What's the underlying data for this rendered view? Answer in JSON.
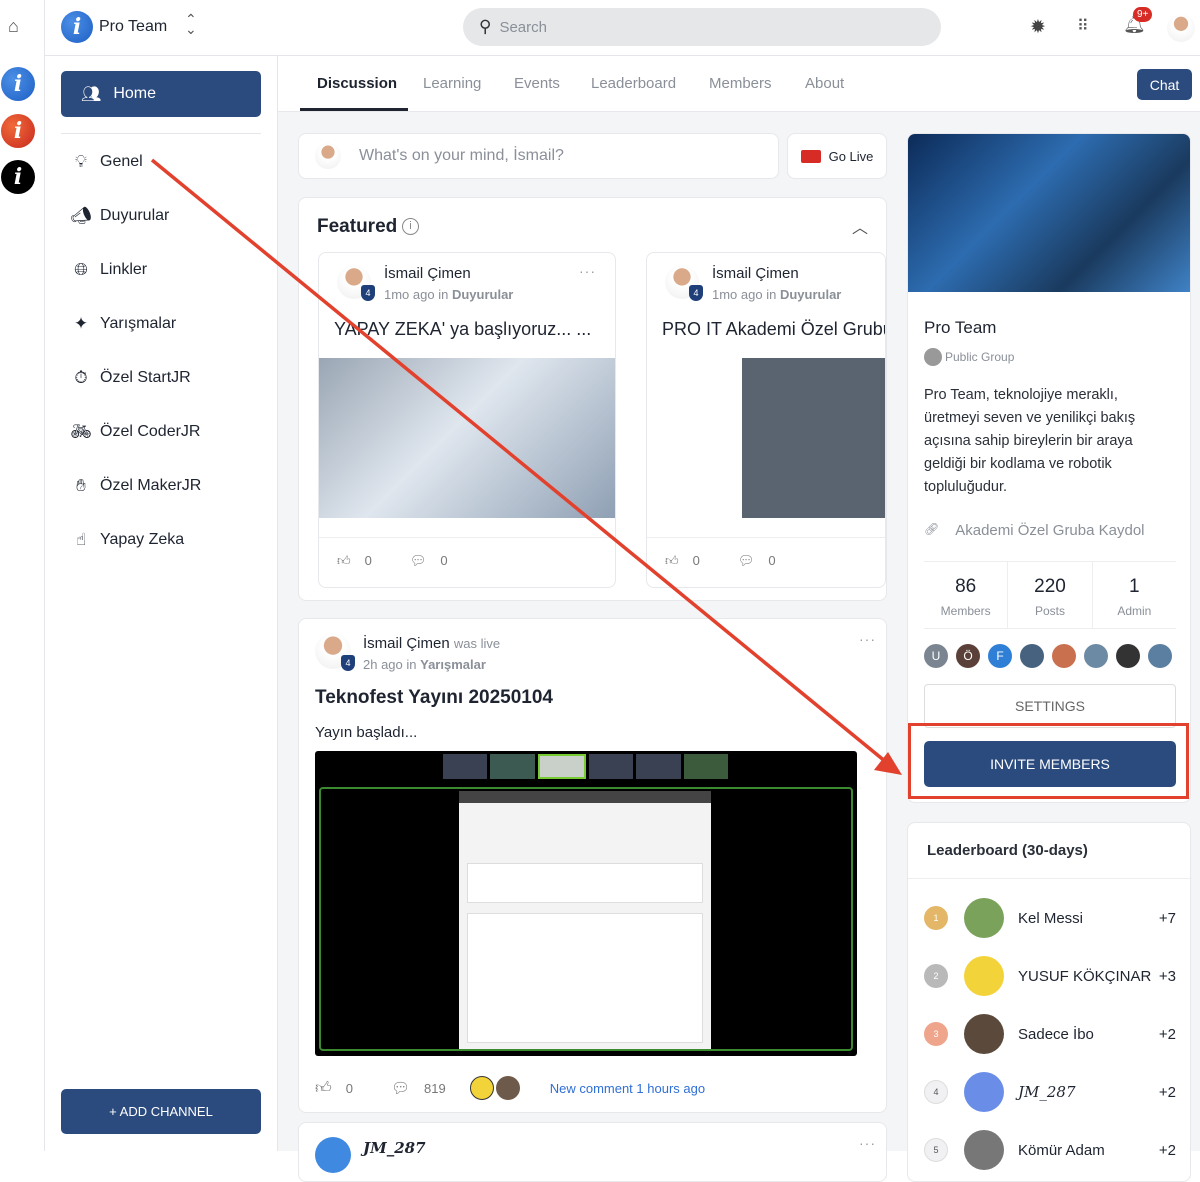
{
  "topbar": {
    "group_name": "Pro Team",
    "search_placeholder": "Search",
    "notif_badge": "9+"
  },
  "sidebar": {
    "home_label": "Home",
    "items": [
      {
        "label": "Genel",
        "icon": "lightbulb-icon"
      },
      {
        "label": "Duyurular",
        "icon": "megaphone-icon"
      },
      {
        "label": "Linkler",
        "icon": "globe-icon"
      },
      {
        "label": "Yarışmalar",
        "icon": "sparkle-icon"
      },
      {
        "label": "Özel StartJR",
        "icon": "timer-icon"
      },
      {
        "label": "Özel CoderJR",
        "icon": "bike-icon"
      },
      {
        "label": "Özel MakerJR",
        "icon": "hand-icon"
      },
      {
        "label": "Yapay Zeka",
        "icon": "pointer-icon"
      }
    ],
    "add_channel": "+ ADD CHANNEL"
  },
  "tabs": [
    "Discussion",
    "Learning",
    "Events",
    "Leaderboard",
    "Members",
    "About"
  ],
  "chat_label": "Chat",
  "composer": {
    "placeholder": "What's on your mind, İsmail?",
    "go_live": "Go Live"
  },
  "featured": {
    "title": "Featured",
    "posts": [
      {
        "author": "İsmail Çimen",
        "badge": "4",
        "time": "1mo ago in",
        "channel": "Duyurular",
        "title": "YAPAY ZEKA' ya başlıyoruz... ...",
        "likes": "0",
        "comments": "0"
      },
      {
        "author": "İsmail Çimen",
        "badge": "4",
        "time": "1mo ago in",
        "channel": "Duyurular",
        "title": "PRO IT Akademi Özel Grubu",
        "likes": "0",
        "comments": "0"
      }
    ]
  },
  "post": {
    "author": "İsmail Çimen",
    "status": "was live",
    "badge": "4",
    "time": "2h ago in",
    "channel": "Yarışmalar",
    "title": "Teknofest Yayını 20250104",
    "body": "Yayın başladı...",
    "likes": "0",
    "comments": "819",
    "new_comment": "New comment 1 hours ago"
  },
  "next_post": {
    "author": "JM_287"
  },
  "group": {
    "name": "Pro Team",
    "privacy": "Public Group",
    "description": "Pro Team, teknolojiye meraklı, üretmeyi seven ve yenilikçi bakış açısına sahip bireylerin bir araya geldiği bir kodlama ve robotik topluluğudur.",
    "link": "Akademi Özel Gruba Kaydol",
    "stats": [
      {
        "value": "86",
        "label": "Members"
      },
      {
        "value": "220",
        "label": "Posts"
      },
      {
        "value": "1",
        "label": "Admin"
      }
    ],
    "member_initials": [
      "U",
      "Ö",
      "F"
    ],
    "settings": "SETTINGS",
    "invite": "INVITE MEMBERS"
  },
  "leaderboard": {
    "title": "Leaderboard (30-days)",
    "rows": [
      {
        "rank": "1",
        "name": "Kel Messi",
        "points": "+7"
      },
      {
        "rank": "2",
        "name": "YUSUF KÖKÇINAR",
        "points": "+3"
      },
      {
        "rank": "3",
        "name": "Sadece İbo",
        "points": "+2"
      },
      {
        "rank": "4",
        "name": "JM_287",
        "points": "+2"
      },
      {
        "rank": "5",
        "name": "Kömür Adam",
        "points": "+2"
      }
    ]
  },
  "colors": {
    "primary": "#2b4a7e",
    "annotation": "#e2412d",
    "link": "#2f6fd6"
  }
}
